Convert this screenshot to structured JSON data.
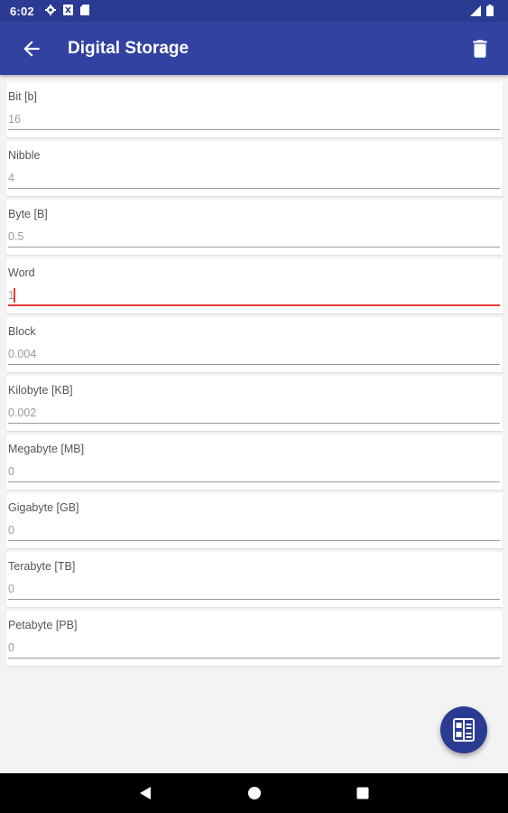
{
  "status_bar": {
    "time": "6:02",
    "left_icons": [
      "gear-icon",
      "notification-icon",
      "sd-card-icon"
    ],
    "right_icons": [
      "signal-icon",
      "battery-icon"
    ]
  },
  "app_bar": {
    "title": "Digital Storage",
    "back_icon": "arrow-left-icon",
    "delete_icon": "trash-icon",
    "color": "#3142a0"
  },
  "units": [
    {
      "label": "Bit [b]",
      "value": "16"
    },
    {
      "label": "Nibble",
      "value": "4"
    },
    {
      "label": "Byte [B]",
      "value": "0.5"
    },
    {
      "label": "Word",
      "value": "1",
      "active": true
    },
    {
      "label": "Block",
      "value": "0.004"
    },
    {
      "label": "Kilobyte [KB]",
      "value": "0.002"
    },
    {
      "label": "Megabyte [MB]",
      "value": "0"
    },
    {
      "label": "Gigabyte [GB]",
      "value": "0"
    },
    {
      "label": "Terabyte [TB]",
      "value": "0"
    },
    {
      "label": "Petabyte [PB]",
      "value": "0"
    }
  ],
  "fab": {
    "icon": "unit-list-icon",
    "color": "#2b3a92"
  },
  "accent_color": "#e53935",
  "nav_bar": {
    "buttons": [
      "back-triangle-icon",
      "home-circle-icon",
      "recents-square-icon"
    ]
  }
}
